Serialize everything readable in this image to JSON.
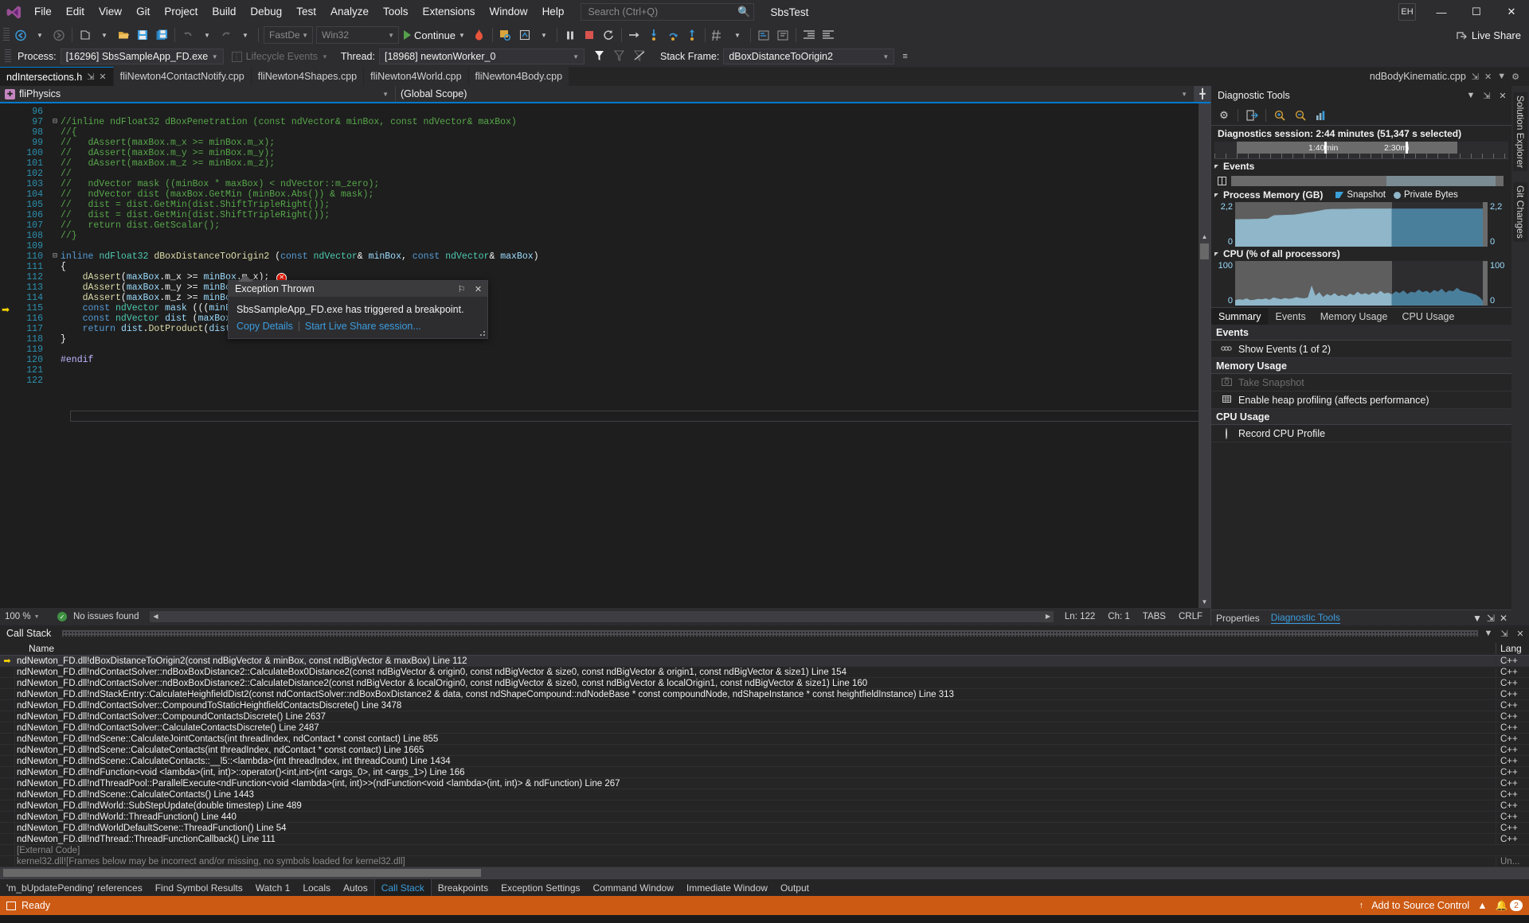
{
  "titlebar": {
    "menus": [
      "File",
      "Edit",
      "View",
      "Git",
      "Project",
      "Build",
      "Debug",
      "Test",
      "Analyze",
      "Tools",
      "Extensions",
      "Window",
      "Help"
    ],
    "search_placeholder": "Search (Ctrl+Q)",
    "solution_name": "SbsTest",
    "account_initials": "EH",
    "minimize": "—",
    "maximize": "☐",
    "close": "✕"
  },
  "toolbar": {
    "config_combo": "FastDebu",
    "platform_combo": "Win32",
    "continue_label": "Continue",
    "live_share_label": "Live Share"
  },
  "processbar": {
    "process_label": "Process:",
    "process_value": "[16296] SbsSampleApp_FD.exe",
    "lifecycle_label": "Lifecycle Events",
    "thread_label": "Thread:",
    "thread_value": "[18968] newtonWorker_0",
    "stackframe_label": "Stack Frame:",
    "stackframe_value": "dBoxDistanceToOrigin2"
  },
  "doctabs": {
    "tabs": [
      {
        "label": "ndIntersections.h",
        "active": true
      },
      {
        "label": "fliNewton4ContactNotify.cpp",
        "active": false
      },
      {
        "label": "fliNewton4Shapes.cpp",
        "active": false
      },
      {
        "label": "fliNewton4World.cpp",
        "active": false
      },
      {
        "label": "fliNewton4Body.cpp",
        "active": false
      }
    ],
    "right_tab": "ndBodyKinematic.cpp"
  },
  "navbar": {
    "project_scope": "fliPhysics",
    "member_scope": "(Global Scope)"
  },
  "code": {
    "lines": [
      {
        "n": "96",
        "fold": "",
        "text": "",
        "cur": false
      },
      {
        "n": "97",
        "fold": "⊟",
        "text": "//inline ndFloat32 dBoxPenetration (const ndVector& minBox, const ndVector& maxBox)",
        "cur": false
      },
      {
        "n": "98",
        "fold": "",
        "text": "//{",
        "cur": false
      },
      {
        "n": "99",
        "fold": "",
        "text": "//   dAssert(maxBox.m_x >= minBox.m_x);",
        "cur": false
      },
      {
        "n": "100",
        "fold": "",
        "text": "//   dAssert(maxBox.m_y >= minBox.m_y);",
        "cur": false
      },
      {
        "n": "101",
        "fold": "",
        "text": "//   dAssert(maxBox.m_z >= minBox.m_z);",
        "cur": false
      },
      {
        "n": "102",
        "fold": "",
        "text": "//",
        "cur": false
      },
      {
        "n": "103",
        "fold": "",
        "text": "//   ndVector mask ((minBox * maxBox) < ndVector::m_zero);",
        "cur": false
      },
      {
        "n": "104",
        "fold": "",
        "text": "//   ndVector dist (maxBox.GetMin (minBox.Abs()) & mask);",
        "cur": false
      },
      {
        "n": "105",
        "fold": "",
        "text": "//   dist = dist.GetMin(dist.ShiftTripleRight());",
        "cur": false
      },
      {
        "n": "106",
        "fold": "",
        "text": "//   dist = dist.GetMin(dist.ShiftTripleRight());",
        "cur": false
      },
      {
        "n": "107",
        "fold": "",
        "text": "//   return dist.GetScalar();",
        "cur": false
      },
      {
        "n": "108",
        "fold": "",
        "text": "//}",
        "cur": false
      },
      {
        "n": "109",
        "fold": "",
        "text": "",
        "cur": false
      },
      {
        "n": "110",
        "fold": "⊟",
        "text": "inline ndFloat32 dBoxDistanceToOrigin2 (const ndVector& minBox, const ndVector& maxBox)",
        "cur": false
      },
      {
        "n": "111",
        "fold": "",
        "text": "{",
        "cur": false
      },
      {
        "n": "112",
        "fold": "",
        "text": "    dAssert(maxBox.m_x >= minBox.m_x);",
        "cur": true
      },
      {
        "n": "113",
        "fold": "",
        "text": "    dAssert(maxBox.m_y >= minBox.m_y);",
        "cur": false
      },
      {
        "n": "114",
        "fold": "",
        "text": "    dAssert(maxBox.m_z >= minBox.m_z);",
        "cur": false
      },
      {
        "n": "115",
        "fold": "",
        "text": "    const ndVector mask (((minBox * max",
        "cur": false
      },
      {
        "n": "116",
        "fold": "",
        "text": "    const ndVector dist (maxBox.Abs().G",
        "cur": false
      },
      {
        "n": "117",
        "fold": "",
        "text": "    return dist.DotProduct(dist).GetSca",
        "cur": false
      },
      {
        "n": "118",
        "fold": "",
        "text": "}",
        "cur": false
      },
      {
        "n": "119",
        "fold": "",
        "text": "",
        "cur": false
      },
      {
        "n": "120",
        "fold": "",
        "text": "#endif",
        "cur": false
      },
      {
        "n": "121",
        "fold": "",
        "text": "",
        "cur": false
      },
      {
        "n": "122",
        "fold": "",
        "text": "",
        "cur": false
      }
    ],
    "error_marker": "✕"
  },
  "exception": {
    "title": "Exception Thrown",
    "message": "SbsSampleApp_FD.exe has triggered a breakpoint.",
    "copy_details": "Copy Details",
    "live_share": "Start Live Share session...",
    "pin_icon": "⚐",
    "close_icon": "✕"
  },
  "editor_status": {
    "zoom": "100 %",
    "issues": "No issues found",
    "line": "Ln: 122",
    "char": "Ch: 1",
    "tabs": "TABS",
    "eol": "CRLF"
  },
  "diagnostics": {
    "panel_title": "Diagnostic Tools",
    "session_text": "Diagnostics session: 2:44 minutes (51,347 s selected)",
    "timeline": {
      "label_1": "1:40min",
      "label_2": "2:30mi"
    },
    "events_section": "Events",
    "memory_section": "Process Memory (GB)",
    "memory_legend_snapshot": "Snapshot",
    "memory_legend_private": "Private Bytes",
    "memory_axis_top": "2,2",
    "memory_axis_bottom": "0",
    "cpu_section": "CPU (% of all processors)",
    "cpu_axis_top": "100",
    "cpu_axis_bottom": "0",
    "tabs": [
      {
        "label": "Summary",
        "active": true
      },
      {
        "label": "Events",
        "active": false
      },
      {
        "label": "Memory Usage",
        "active": false
      },
      {
        "label": "CPU Usage",
        "active": false
      }
    ],
    "sections": [
      {
        "title": "Events",
        "items": [
          {
            "label": "Show Events (1 of 2)",
            "icon": "⦿⦿",
            "disabled": false,
            "type": "eye"
          }
        ]
      },
      {
        "title": "Memory Usage",
        "items": [
          {
            "label": "Take Snapshot",
            "icon": "▣",
            "disabled": true,
            "type": "camera"
          },
          {
            "label": "Enable heap profiling (affects performance)",
            "icon": "▤",
            "disabled": false,
            "type": "heap"
          }
        ]
      },
      {
        "title": "CPU Usage",
        "items": [
          {
            "label": "Record CPU Profile",
            "icon": "",
            "disabled": false,
            "type": "radio"
          }
        ]
      }
    ],
    "footer_tabs": [
      "Properties",
      "Diagnostic Tools"
    ],
    "footer_active": "Diagnostic Tools"
  },
  "chart_data": [
    {
      "type": "area",
      "title": "Process Memory (GB)",
      "ylabel": "GB",
      "ylim": [
        0,
        2.2
      ],
      "tick_labels": [
        "0",
        "2,2"
      ],
      "legend": [
        "Snapshot",
        "Private Bytes"
      ],
      "legend_position": "top-right",
      "grid": false,
      "series": [
        {
          "name": "Private Bytes",
          "values": [
            1.35,
            1.36,
            1.36,
            1.37,
            1.37,
            1.38,
            1.55,
            1.56,
            1.57,
            1.58,
            1.62,
            1.68,
            1.72,
            1.78,
            1.84,
            1.86,
            1.86,
            1.86,
            1.87,
            1.88,
            1.88,
            1.88,
            1.88,
            1.88,
            1.88,
            1.88,
            1.88,
            1.88,
            1.88,
            1.88,
            1.88,
            1.88,
            1.88,
            1.88,
            1.88,
            1.88,
            1.88,
            1.88,
            1.88,
            1.88
          ]
        }
      ],
      "selection_start_pct": 62,
      "selection_color": "#4a7f9c",
      "unselected_color": "#8fb6c9"
    },
    {
      "type": "area",
      "title": "CPU (% of all processors)",
      "ylabel": "%",
      "ylim": [
        0,
        100
      ],
      "tick_labels": [
        "0",
        "100"
      ],
      "grid": false,
      "series": [
        {
          "name": "CPU",
          "values": [
            12,
            14,
            13,
            16,
            12,
            13,
            15,
            14,
            16,
            13,
            18,
            16,
            14,
            17,
            15,
            16,
            19,
            17,
            16,
            18,
            45,
            22,
            30,
            19,
            26,
            22,
            28,
            21,
            24,
            20,
            27,
            23,
            31,
            25,
            28,
            24,
            30,
            26,
            33,
            27,
            29,
            25,
            32,
            28,
            34,
            26,
            31,
            29,
            36,
            30,
            33,
            28,
            35,
            31,
            38,
            29,
            34,
            32,
            40,
            33,
            31,
            29,
            27,
            24,
            18,
            8,
            5
          ]
        }
      ],
      "selection_start_pct": 62,
      "selection_color": "#4a7f9c",
      "unselected_color": "#8fb6c9"
    }
  ],
  "callstack": {
    "panel_title": "Call Stack",
    "col_name": "Name",
    "col_lang": "Lang",
    "rows": [
      {
        "name": "ndNewton_FD.dll!dBoxDistanceToOrigin2(const ndBigVector & minBox, const ndBigVector & maxBox) Line 112",
        "lang": "C++",
        "current": true,
        "dim": false
      },
      {
        "name": "ndNewton_FD.dll!ndContactSolver::ndBoxBoxDistance2::CalculateBox0Distance2(const ndBigVector & origin0, const ndBigVector & size0, const ndBigVector & origin1, const ndBigVector & size1) Line 154",
        "lang": "C++",
        "current": false,
        "dim": false
      },
      {
        "name": "ndNewton_FD.dll!ndContactSolver::ndBoxBoxDistance2::CalculateDistance2(const ndBigVector & localOrigin0, const ndBigVector & size0, const ndBigVector & localOrigin1, const ndBigVector & size1) Line 160",
        "lang": "C++",
        "current": false,
        "dim": false
      },
      {
        "name": "ndNewton_FD.dll!ndStackEntry::CalculateHeighfieldDist2(const ndContactSolver::ndBoxBoxDistance2 & data, const ndShapeCompound::ndNodeBase * const compoundNode, ndShapeInstance * const heightfieldInstance) Line 313",
        "lang": "C++",
        "current": false,
        "dim": false
      },
      {
        "name": "ndNewton_FD.dll!ndContactSolver::CompoundToStaticHeightfieldContactsDiscrete() Line 3478",
        "lang": "C++",
        "current": false,
        "dim": false
      },
      {
        "name": "ndNewton_FD.dll!ndContactSolver::CompoundContactsDiscrete() Line 2637",
        "lang": "C++",
        "current": false,
        "dim": false
      },
      {
        "name": "ndNewton_FD.dll!ndContactSolver::CalculateContactsDiscrete() Line 2487",
        "lang": "C++",
        "current": false,
        "dim": false
      },
      {
        "name": "ndNewton_FD.dll!ndScene::CalculateJointContacts(int threadIndex, ndContact * const contact) Line 855",
        "lang": "C++",
        "current": false,
        "dim": false
      },
      {
        "name": "ndNewton_FD.dll!ndScene::CalculateContacts(int threadIndex, ndContact * const contact) Line 1665",
        "lang": "C++",
        "current": false,
        "dim": false
      },
      {
        "name": "ndNewton_FD.dll!ndScene::CalculateContacts::__l5::<lambda>(int threadIndex, int threadCount) Line 1434",
        "lang": "C++",
        "current": false,
        "dim": false
      },
      {
        "name": "ndNewton_FD.dll!ndFunction<void <lambda>(int, int)>::operator()<int,int>(int <args_0>, int <args_1>) Line 166",
        "lang": "C++",
        "current": false,
        "dim": false
      },
      {
        "name": "ndNewton_FD.dll!ndThreadPool::ParallelExecute<ndFunction<void <lambda>(int, int)>>(ndFunction<void <lambda>(int, int)> & ndFunction) Line 267",
        "lang": "C++",
        "current": false,
        "dim": false
      },
      {
        "name": "ndNewton_FD.dll!ndScene::CalculateContacts() Line 1443",
        "lang": "C++",
        "current": false,
        "dim": false
      },
      {
        "name": "ndNewton_FD.dll!ndWorld::SubStepUpdate(double timestep) Line 489",
        "lang": "C++",
        "current": false,
        "dim": false
      },
      {
        "name": "ndNewton_FD.dll!ndWorld::ThreadFunction() Line 440",
        "lang": "C++",
        "current": false,
        "dim": false
      },
      {
        "name": "ndNewton_FD.dll!ndWorldDefaultScene::ThreadFunction() Line 54",
        "lang": "C++",
        "current": false,
        "dim": false
      },
      {
        "name": "ndNewton_FD.dll!ndThread::ThreadFunctionCallback() Line 111",
        "lang": "C++",
        "current": false,
        "dim": false
      },
      {
        "name": "[External Code]",
        "lang": "",
        "current": false,
        "dim": true
      },
      {
        "name": "kernel32.dll![Frames below may be incorrect and/or missing, no symbols loaded for kernel32.dll]",
        "lang": "Un...",
        "current": false,
        "dim": true
      }
    ]
  },
  "bottomtabs": {
    "tabs": [
      {
        "label": "'m_bUpdatePending' references",
        "active": false
      },
      {
        "label": "Find Symbol Results",
        "active": false
      },
      {
        "label": "Watch 1",
        "active": false
      },
      {
        "label": "Locals",
        "active": false
      },
      {
        "label": "Autos",
        "active": false
      },
      {
        "label": "Call Stack",
        "active": true
      },
      {
        "label": "Breakpoints",
        "active": false
      },
      {
        "label": "Exception Settings",
        "active": false
      },
      {
        "label": "Command Window",
        "active": false
      },
      {
        "label": "Immediate Window",
        "active": false
      },
      {
        "label": "Output",
        "active": false
      }
    ]
  },
  "statusbar": {
    "state": "Ready",
    "source_control": "Add to Source Control",
    "notification_count": "2"
  },
  "vstrip": {
    "tabs": [
      "Solution Explorer",
      "Git Changes"
    ]
  }
}
